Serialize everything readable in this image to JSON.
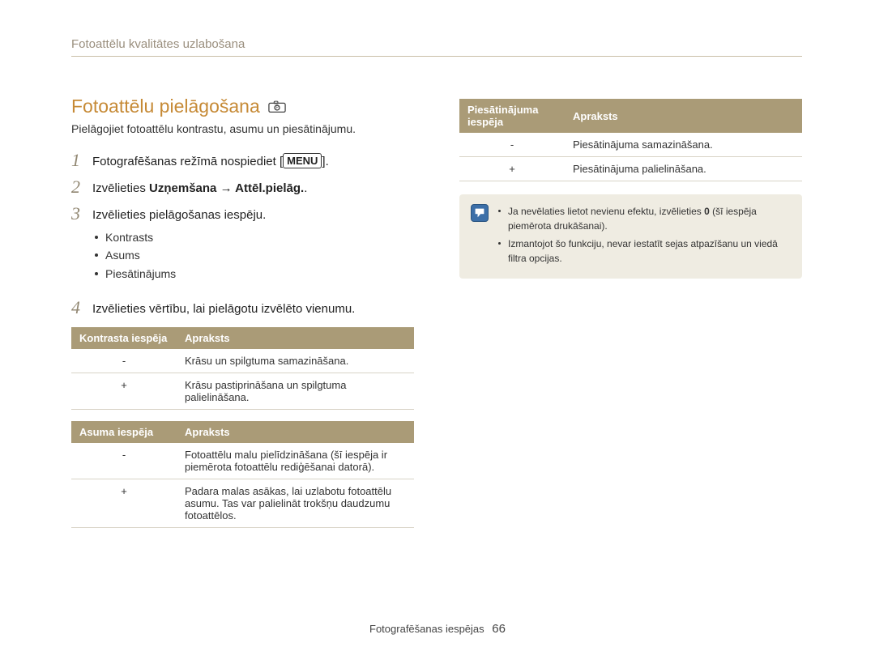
{
  "header": {
    "breadcrumb": "Fotoattēlu kvalitātes uzlabošana"
  },
  "section": {
    "title": "Fotoattēlu pielāgošana",
    "intro": "Pielāgojiet fotoattēlu kontrastu, asumu un piesātinājumu."
  },
  "steps": {
    "s1_pre": "Fotografēšanas režīmā nospiediet [",
    "s1_menu": "MENU",
    "s1_post": "].",
    "s2_pre": "Izvēlieties ",
    "s2_bold": "Uzņemšana → Attēl.pielāg.",
    "s2_post": ".",
    "s3": "Izvēlieties pielāgošanas iespēju.",
    "s3_items": [
      "Kontrasts",
      "Asums",
      "Piesātinājums"
    ],
    "s4": "Izvēlieties vērtību, lai pielāgotu izvēlēto vienumu."
  },
  "tables": {
    "contrast": {
      "h1": "Kontrasta iespēja",
      "h2": "Apraksts",
      "rows": [
        {
          "opt": "-",
          "desc": "Krāsu un spilgtuma samazināšana."
        },
        {
          "opt": "+",
          "desc": "Krāsu pastiprināšana un spilgtuma palielināšana."
        }
      ]
    },
    "sharp": {
      "h1": "Asuma iespēja",
      "h2": "Apraksts",
      "rows": [
        {
          "opt": "-",
          "desc": "Fotoattēlu malu pielīdzināšana (šī iespēja ir piemērota fotoattēlu rediģēšanai datorā)."
        },
        {
          "opt": "+",
          "desc": "Padara malas asākas, lai uzlabotu fotoattēlu asumu. Tas var palielināt trokšņu daudzumu fotoattēlos."
        }
      ]
    },
    "sat": {
      "h1": "Piesātinājuma iespēja",
      "h2": "Apraksts",
      "rows": [
        {
          "opt": "-",
          "desc": "Piesātinājuma samazināšana."
        },
        {
          "opt": "+",
          "desc": "Piesātinājuma palielināšana."
        }
      ]
    }
  },
  "note": {
    "n1_a": "Ja nevēlaties lietot nevienu efektu, izvēlieties ",
    "n1_bold": "0",
    "n1_b": " (šī iespēja piemērota drukāšanai).",
    "n2": "Izmantojot šo funkciju, nevar iestatīt sejas atpazīšanu un viedā filtra opcijas."
  },
  "footer": {
    "label": "Fotografēšanas iespējas",
    "page": "66"
  }
}
